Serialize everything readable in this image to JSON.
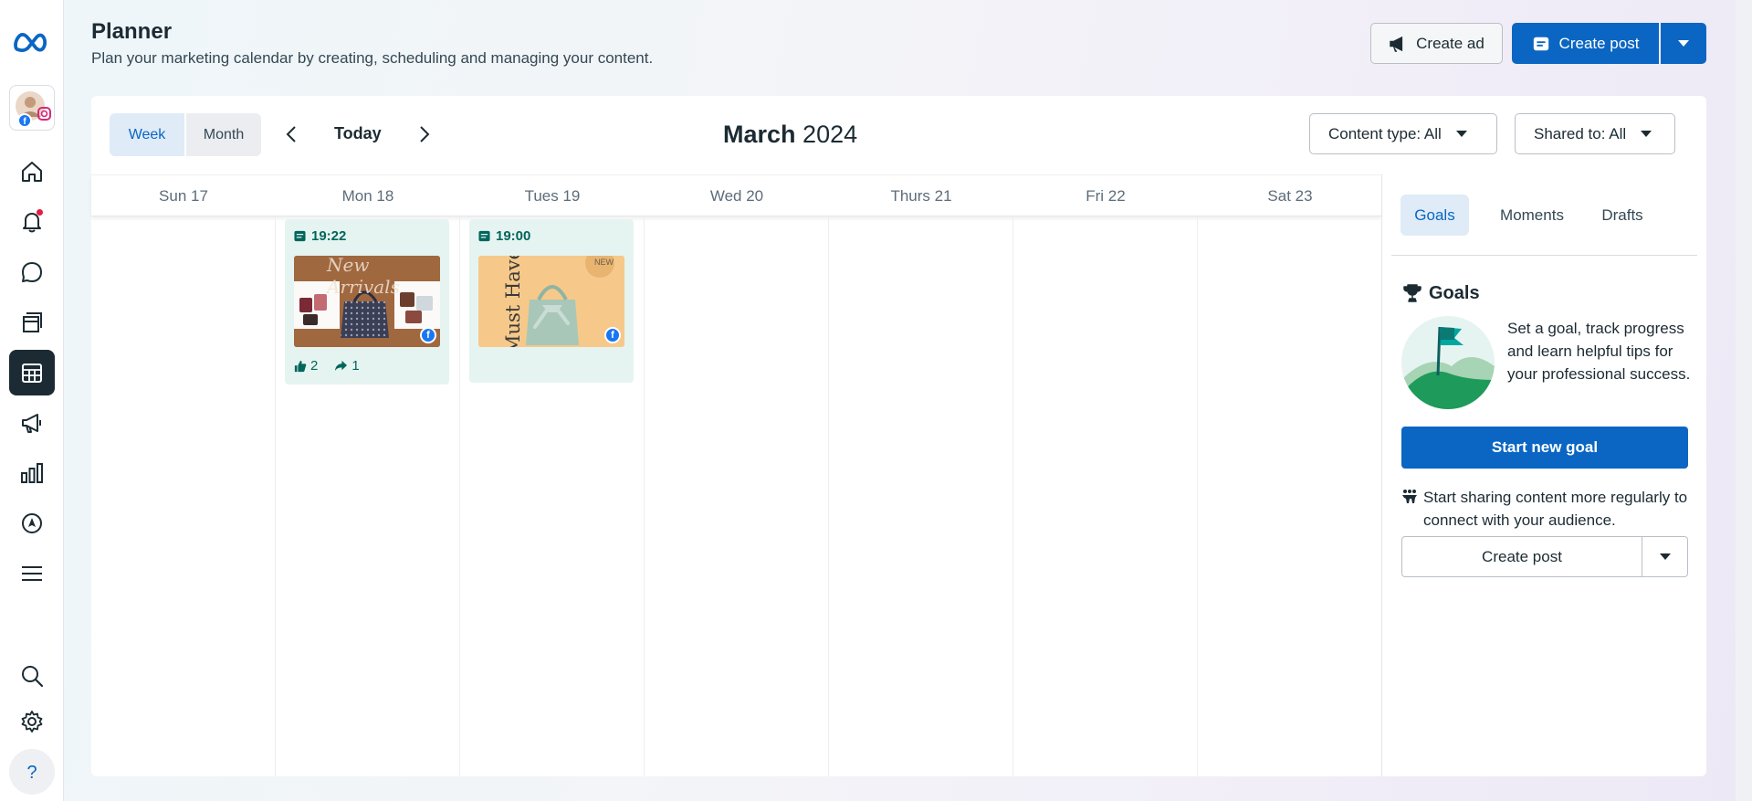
{
  "header": {
    "title": "Planner",
    "subtitle": "Plan your marketing calendar by creating, scheduling and managing your content.",
    "create_ad_label": "Create ad",
    "create_post_label": "Create post"
  },
  "sidebar": {
    "items": [
      {
        "name": "home-icon"
      },
      {
        "name": "notifications-icon",
        "has_badge": true
      },
      {
        "name": "messages-icon"
      },
      {
        "name": "content-icon"
      },
      {
        "name": "planner-icon",
        "active": true
      },
      {
        "name": "ads-icon"
      },
      {
        "name": "insights-icon"
      },
      {
        "name": "explore-icon"
      },
      {
        "name": "menu-icon"
      },
      {
        "name": "search-icon"
      },
      {
        "name": "settings-icon"
      },
      {
        "name": "help-icon"
      }
    ]
  },
  "toolbar": {
    "week_label": "Week",
    "month_label": "Month",
    "today_label": "Today",
    "month_name": "March",
    "year": "2024",
    "content_type_label": "Content type: All",
    "shared_to_label": "Shared to: All"
  },
  "calendar": {
    "days": [
      "Sun 17",
      "Mon 18",
      "Tues 19",
      "Wed 20",
      "Thurs 21",
      "Fri 22",
      "Sat 23"
    ],
    "posts": [
      {
        "day": "Mon 18",
        "time": "19:22",
        "image_text": "New Arrivals",
        "likes": "2",
        "shares": "1"
      },
      {
        "day": "Tues 19",
        "time": "19:00",
        "image_text": "Must Have",
        "badge": "NEW"
      }
    ]
  },
  "panel": {
    "tabs": [
      "Goals",
      "Moments",
      "Drafts"
    ],
    "goals_title": "Goals",
    "goals_text": "Set a goal, track progress and learn helpful tips for your professional success.",
    "start_goal_label": "Start new goal",
    "tip_text": "Start sharing content more regularly to connect with your audience.",
    "create_post_label": "Create post"
  },
  "colors": {
    "accent": "#0a66c2",
    "dark": "#1c2b33",
    "post_bg": "#e6f4f1",
    "post_text": "#00665c"
  }
}
